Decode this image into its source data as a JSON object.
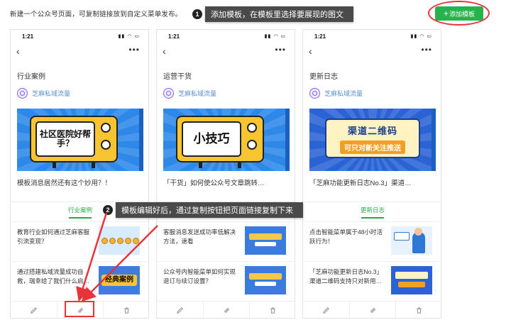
{
  "intro_text": "新建一个公众号页面，可复制链接放到自定义菜单发布。",
  "add_template_button": "添加模板",
  "callout_1": {
    "step": "1",
    "text": "添加模板，在模板里选择要展现的图文"
  },
  "callout_2": {
    "step": "2",
    "text": "模板编辑好后，通过复制按钮把页面链接复制下来"
  },
  "status_time": "1:21",
  "account_name": "芝麻私域流量",
  "accent_color": "#27b34b",
  "annotation_color": "#e8333a",
  "cards": [
    {
      "page_title": "行业案例",
      "banner_text": "社区医院好帮手？",
      "banner_title": "模板消息居然还有这个妙用？！",
      "tab": "行业案例",
      "items": [
        {
          "text": "教育行业如何通过芝麻客服引流变现？"
        },
        {
          "text": "通过搭建私域流量成功自救，瑞幸给了我们什么启…",
          "thumb_text": "经典案例"
        }
      ]
    },
    {
      "page_title": "运营干货",
      "banner_text": "小技巧",
      "banner_title": "「干货」如何使公众号文章跳转…",
      "tab": "",
      "items": [
        {
          "text": "客服消息发送成功率低解决方法，速看"
        },
        {
          "text": "公众号内智能菜单如何实现退订与续订设置？"
        }
      ]
    },
    {
      "page_title": "更新日志",
      "banner_line1": "渠道二维码",
      "banner_line2": "可只对新关注推送",
      "banner_title": "「芝麻功能更新日志No.3」渠道…",
      "tab": "更新日志",
      "items": [
        {
          "text": "点击智能菜单属于48小时活跃行为！"
        },
        {
          "text": "「芝麻功能更新日志No.3」渠道二维码支持只对新用…"
        }
      ]
    }
  ],
  "footer_icons": [
    "pencil-icon",
    "link-icon",
    "trash-icon"
  ]
}
